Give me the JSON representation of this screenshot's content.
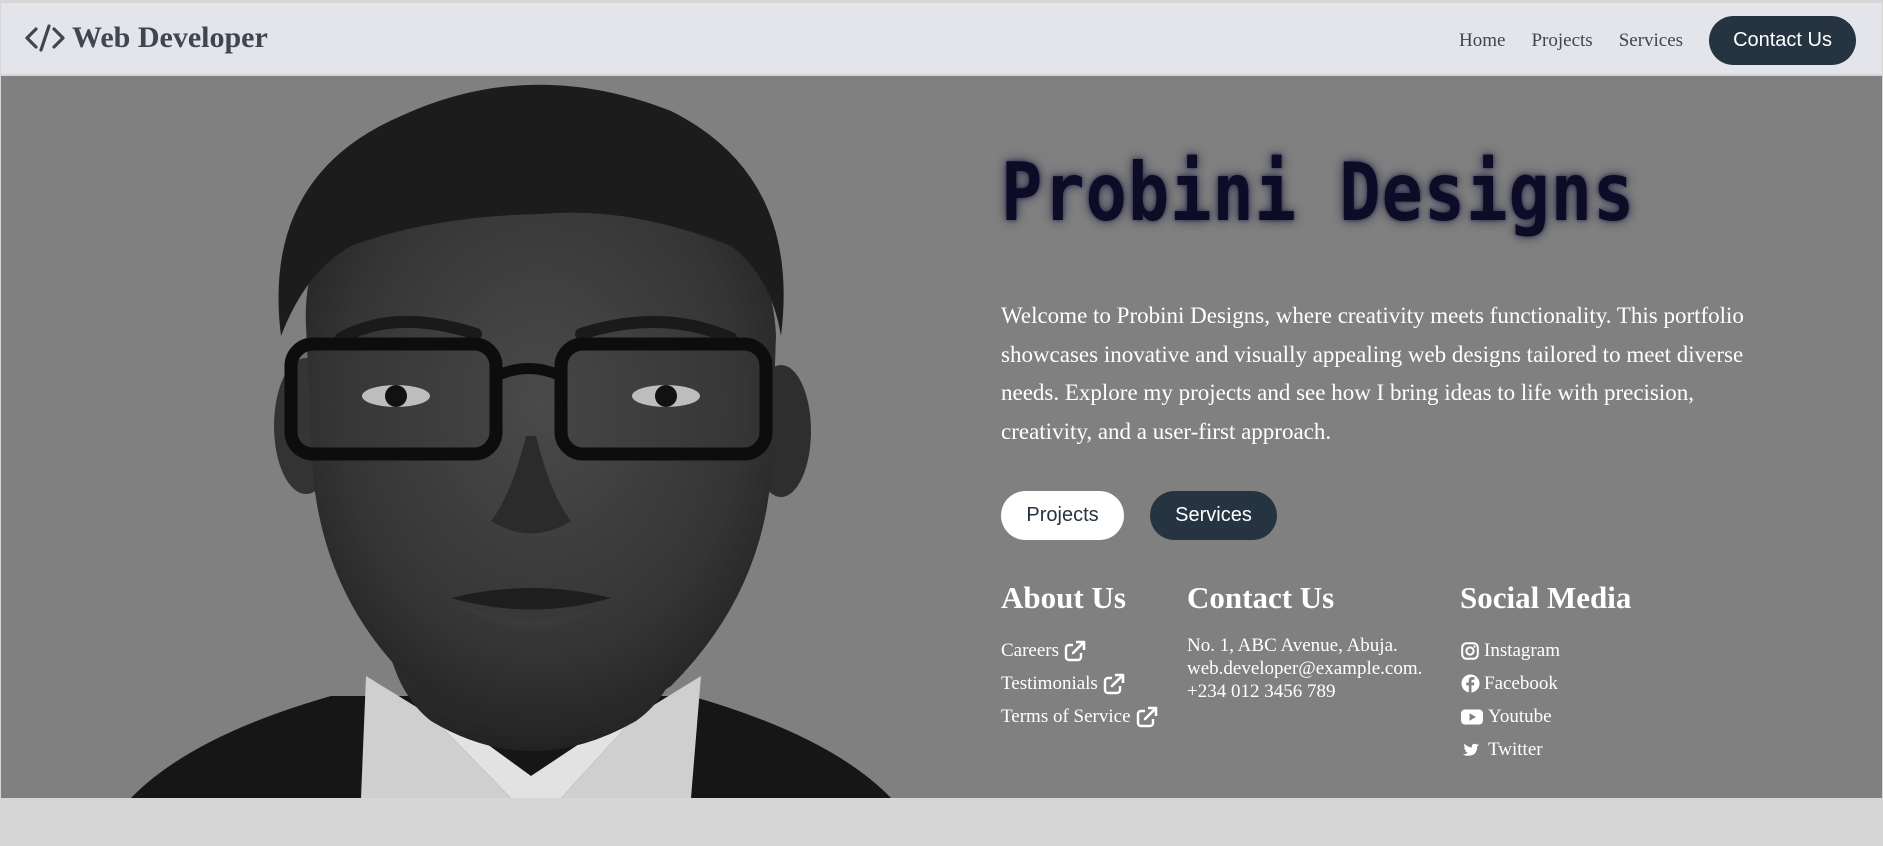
{
  "nav": {
    "brand": "Web Developer",
    "brand_icon": "code-icon",
    "links": [
      "Home",
      "Projects",
      "Services"
    ],
    "contact_label": "Contact Us"
  },
  "hero": {
    "title": "Probini Designs",
    "intro": "Welcome to Probini Designs, where creativity meets functionality. This portfolio showcases inovative and visually appealing web designs tailored to meet diverse needs. Explore my projects and see how I bring ideas to life with precision, creativity, and a user-first approach.",
    "buttons": [
      "Projects",
      "Services"
    ]
  },
  "about": {
    "heading": "About Us",
    "links": [
      "Careers",
      "Testimonials",
      "Terms of Service"
    ],
    "link_icon": "external-link-icon"
  },
  "contact": {
    "heading": "Contact Us",
    "address": "No. 1, ABC Avenue, Abuja.",
    "email": "web.developer@example.com.",
    "phone": "+234 012 3456 789"
  },
  "social": {
    "heading": "Social Media",
    "items": [
      {
        "label": "Instagram",
        "icon": "instagram-icon"
      },
      {
        "label": "Facebook",
        "icon": "facebook-icon"
      },
      {
        "label": "Youtube",
        "icon": "youtube-icon"
      },
      {
        "label": "Twitter",
        "icon": "twitter-icon"
      }
    ]
  },
  "colors": {
    "nav_bg": "#e4e5ea",
    "hero_bg": "#808080",
    "accent_dark": "#263442",
    "title_color": "#0c0c26",
    "page_bg": "#d6d6d6"
  }
}
